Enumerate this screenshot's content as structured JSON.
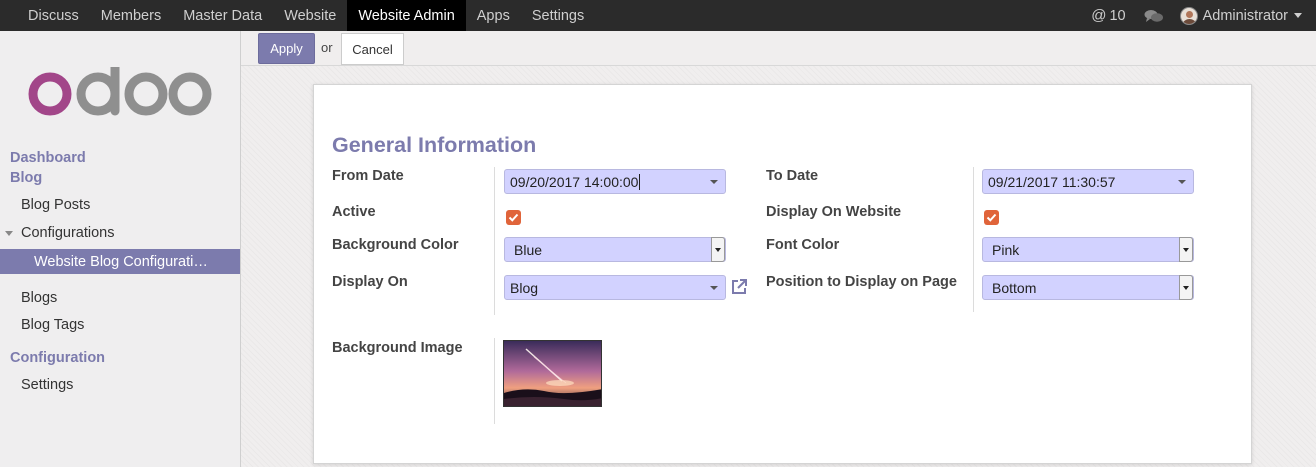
{
  "topbar": {
    "menu": [
      "Discuss",
      "Members",
      "Master Data",
      "Website",
      "Website Admin",
      "Apps",
      "Settings"
    ],
    "active_menu": "Website Admin",
    "mentions_count": "10",
    "user_name": "Administrator"
  },
  "sidebar": {
    "logo_text": "odoo",
    "dashboard": "Dashboard",
    "blog_section": "Blog",
    "blog_posts": "Blog Posts",
    "configurations": "Configurations",
    "website_blog_config": "Website Blog Configurati…",
    "blogs": "Blogs",
    "blog_tags": "Blog Tags",
    "configuration_section": "Configuration",
    "settings": "Settings"
  },
  "actions": {
    "apply": "Apply",
    "or": "or",
    "cancel": "Cancel"
  },
  "form": {
    "section_title": "General Information",
    "from_date_label": "From Date",
    "from_date_value": "09/20/2017 14:00:00",
    "to_date_label": "To Date",
    "to_date_value": "09/21/2017 11:30:57",
    "active_label": "Active",
    "active_checked": true,
    "display_on_website_label": "Display On Website",
    "display_on_website_checked": true,
    "background_color_label": "Background Color",
    "background_color_value": "Blue",
    "font_color_label": "Font Color",
    "font_color_value": "Pink",
    "display_on_label": "Display On",
    "display_on_value": "Blog",
    "position_label": "Position to Display on Page",
    "position_value": "Bottom",
    "background_image_label": "Background Image"
  },
  "colors": {
    "brand": "#7c7bad",
    "field_bg": "#d2d2ff",
    "checkbox": "#e0643a",
    "topbar": "#2b2b2b"
  }
}
